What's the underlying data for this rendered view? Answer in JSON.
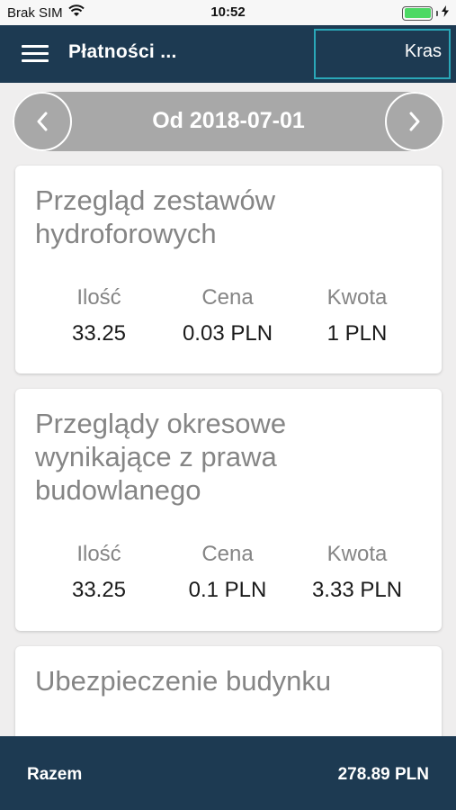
{
  "status_bar": {
    "carrier": "Brak SIM",
    "time": "10:52",
    "wifi_icon": "wifi-icon",
    "battery_icon": "battery-icon",
    "charging_icon": "charging-bolt-icon"
  },
  "header": {
    "menu_icon": "hamburger-menu-icon",
    "title": "Płatności ...",
    "field_value": "Kras"
  },
  "date_nav": {
    "prev_icon": "chevron-left-icon",
    "label": "Od 2018-07-01",
    "next_icon": "chevron-right-icon"
  },
  "columns": {
    "qty": "Ilość",
    "price": "Cena",
    "amount": "Kwota"
  },
  "items": [
    {
      "title": "Przegląd zestawów hydroforowych",
      "qty": "33.25",
      "price": "0.03 PLN",
      "amount": "1 PLN"
    },
    {
      "title": "Przeglądy okresowe wynikające z prawa budowlanego",
      "qty": "33.25",
      "price": "0.1 PLN",
      "amount": "3.33 PLN"
    },
    {
      "title": "Ubezpieczenie budynku"
    }
  ],
  "footer": {
    "label": "Razem",
    "total": "278.89 PLN"
  },
  "colors": {
    "nav_background": "#1d3a52",
    "field_border": "#2aa7b8",
    "date_nav_background": "#a8a8a8",
    "page_background": "#efeeee"
  }
}
